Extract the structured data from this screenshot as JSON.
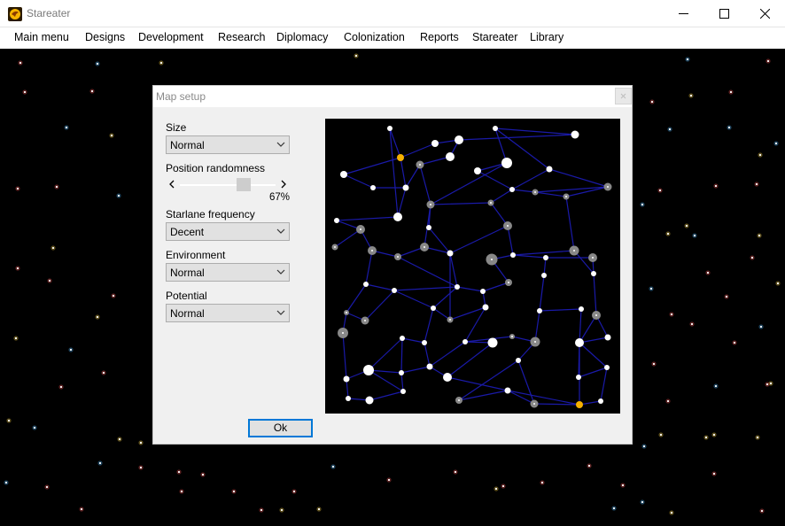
{
  "window": {
    "title": "Stareater",
    "controls": [
      "minimize-icon",
      "maximize-icon",
      "close-icon"
    ]
  },
  "menu": [
    {
      "label": "Main menu"
    },
    {
      "label": "Designs"
    },
    {
      "label": "Development"
    },
    {
      "label": "Research"
    },
    {
      "label": "Diplomacy"
    },
    {
      "label": "Colonization"
    },
    {
      "label": "Reports"
    },
    {
      "label": "Stareater"
    },
    {
      "label": "Library"
    }
  ],
  "dialog": {
    "title": "Map setup",
    "size": {
      "label": "Size",
      "value": "Normal"
    },
    "position_randomness": {
      "label": "Position randomness",
      "value_text": "67%",
      "value": 0.67
    },
    "starlane_frequency": {
      "label": "Starlane frequency",
      "value": "Decent"
    },
    "environment": {
      "label": "Environment",
      "value": "Normal"
    },
    "potential": {
      "label": "Potential",
      "value": "Normal"
    },
    "ok_label": "Ok"
  },
  "colors": {
    "background": "#000000",
    "starlane": "#1a1aa8",
    "star_white": "#ffffff",
    "star_gray": "#888888",
    "star_home": "#f5b000"
  }
}
